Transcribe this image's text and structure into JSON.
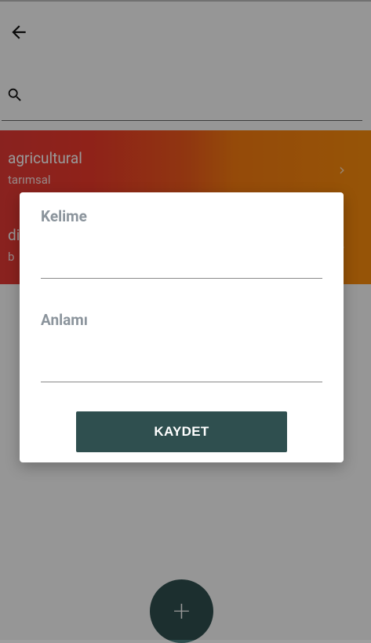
{
  "header": {
    "back_icon": "arrow-left-icon"
  },
  "search": {
    "icon": "search-icon",
    "value": "",
    "placeholder": ""
  },
  "list": {
    "items": [
      {
        "word": "agricultural",
        "meaning": "tarımsal",
        "chevron": "›"
      },
      {
        "word": "di",
        "meaning": "b",
        "chevron": "›"
      }
    ],
    "colors": {
      "gradient_start": "#e53935",
      "gradient_end": "#fb8d0c"
    }
  },
  "fab": {
    "label": "+",
    "color": "#2f4f4f"
  },
  "dialog": {
    "word_label": "Kelime",
    "word_value": "",
    "meaning_label": "Anlamı",
    "meaning_value": "",
    "save_label": "KAYDET",
    "button_color": "#2f4f4f"
  }
}
